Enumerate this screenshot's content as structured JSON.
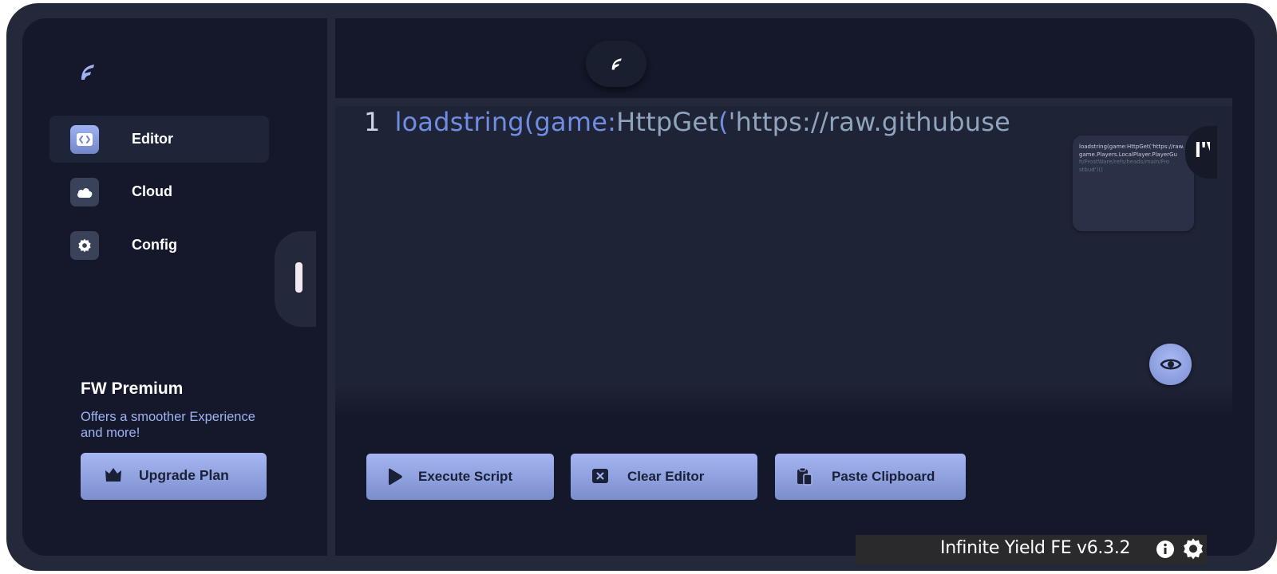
{
  "sidebar": {
    "items": [
      {
        "label": "Editor",
        "icon": "code-icon",
        "active": true
      },
      {
        "label": "Cloud",
        "icon": "cloud-icon",
        "active": false
      },
      {
        "label": "Config",
        "icon": "gear-icon",
        "active": false
      }
    ],
    "premium": {
      "title": "FW Premium",
      "description": "Offers a smoother Experience and more!",
      "button_label": "Upgrade Plan",
      "button_icon": "crown-icon"
    }
  },
  "editor": {
    "line_number": "1",
    "code": {
      "fn": "loadstring",
      "open1": "(",
      "game": "game:",
      "method": "HttpGet",
      "open2": "(",
      "string": "'https://raw.githubuse"
    },
    "minimap_lines": [
      "loadstring(game:HttpGet('https://raw.",
      "game.Players.LocalPlayer.PlayerGu",
      "h/FrostWare/refs/heads/main/Fro",
      "stbud')()"
    ],
    "minimap_corner_text": "I'V"
  },
  "actions": {
    "execute": {
      "label": "Execute Script",
      "icon": "play-icon"
    },
    "clear": {
      "label": "Clear Editor",
      "icon": "close-icon"
    },
    "paste": {
      "label": "Paste Clipboard",
      "icon": "clipboard-icon"
    }
  },
  "status_bar": {
    "title": "Infinite Yield FE v6.3.2",
    "info_icon": "info-icon",
    "settings_icon": "gear-icon"
  },
  "colors": {
    "background": "#14182a",
    "frame": "#23283a",
    "editor_bg": "#1e2335",
    "accent": "#9fb2f2",
    "button_text": "#1a2036"
  }
}
